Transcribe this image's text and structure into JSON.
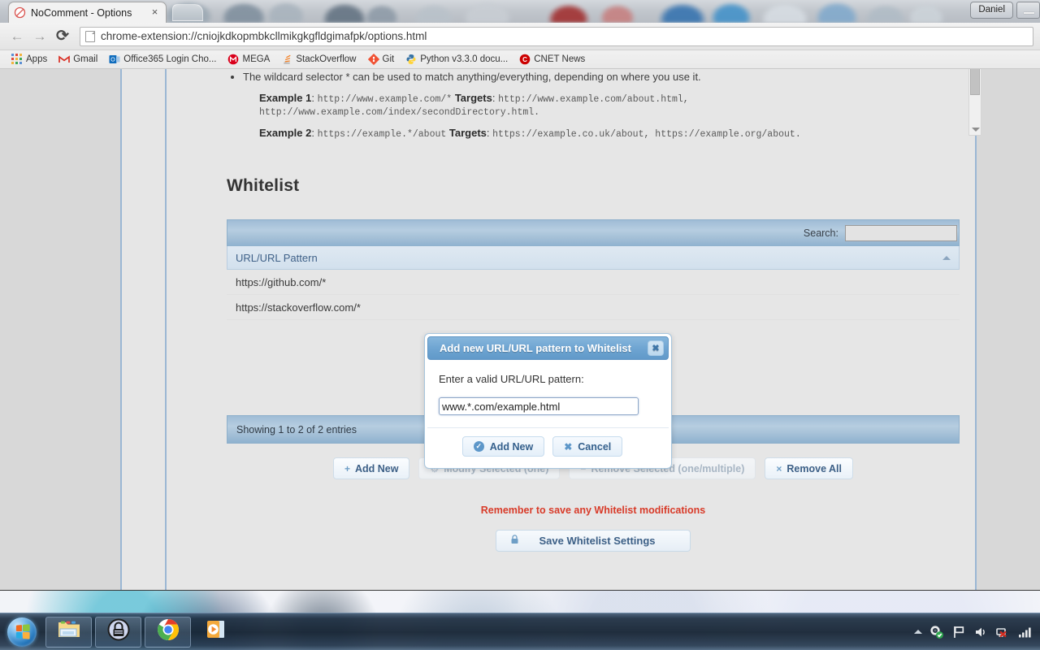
{
  "window": {
    "user_button": "Daniel",
    "minimize_label": "–"
  },
  "browser": {
    "tab": {
      "title": "NoComment - Options",
      "close": "×",
      "favicon": "no-comment-icon"
    },
    "nav": {
      "back": "←",
      "forward": "→",
      "reload": "⟳"
    },
    "omnibox": {
      "url": "chrome-extension://cniojkdkopmbkcllmikgkgfldgimafpk/options.html"
    },
    "bookmarks": [
      {
        "label": "Apps",
        "icon": "apps-grid-icon"
      },
      {
        "label": "Gmail",
        "icon": "gmail-icon"
      },
      {
        "label": "Office365 Login Cho...",
        "icon": "outlook-icon"
      },
      {
        "label": "MEGA",
        "icon": "mega-icon"
      },
      {
        "label": "StackOverflow",
        "icon": "stackoverflow-icon"
      },
      {
        "label": "Git",
        "icon": "git-icon"
      },
      {
        "label": "Python v3.3.0 docu...",
        "icon": "python-icon"
      },
      {
        "label": "CNET News",
        "icon": "cnet-icon"
      }
    ]
  },
  "help": {
    "bullet": "The wildcard selector * can be used to match anything/everything, depending on where you use it.",
    "examples": [
      {
        "name": "Example 1",
        "pattern": "http://www.example.com/*",
        "targets_label": "Targets",
        "targets": "http://www.example.com/about.html, http://www.example.com/index/secondDirectory.html."
      },
      {
        "name": "Example 2",
        "pattern": "https://example.*/about",
        "targets_label": "Targets",
        "targets": "https://example.co.uk/about, https://example.org/about."
      }
    ]
  },
  "whitelist": {
    "heading": "Whitelist",
    "search_label": "Search:",
    "search_value": "",
    "search_placeholder": "",
    "column_header": "URL/URL Pattern",
    "sort_direction": "ascending",
    "rows": [
      "https://github.com/*",
      "https://stackoverflow.com/*"
    ],
    "footer_info": "Showing 1 to 2 of 2 entries",
    "actions": [
      {
        "label": "Add New",
        "glyph": "+",
        "disabled": false,
        "name": "add-new-button"
      },
      {
        "label": "Modify Selected (one)",
        "glyph": "⚙",
        "disabled": true,
        "name": "modify-selected-button"
      },
      {
        "label": "Remove Selected (one/multiple)",
        "glyph": "−",
        "disabled": true,
        "name": "remove-selected-button"
      },
      {
        "label": "Remove All",
        "glyph": "×",
        "disabled": false,
        "name": "remove-all-button"
      }
    ],
    "warning": "Remember to save any Whitelist modifications",
    "save_label": "Save Whitelist Settings",
    "save_glyph": "🔒"
  },
  "modal": {
    "title": "Add new URL/URL pattern to Whitelist",
    "close_glyph": "✖",
    "prompt": "Enter a valid URL/URL pattern:",
    "input_value": "www.*.com/example.html",
    "input_placeholder": "",
    "confirm_label": "Add New",
    "confirm_glyph": "✓",
    "cancel_label": "Cancel",
    "cancel_glyph": "✖"
  },
  "taskbar": {
    "start": "start-orb",
    "items": [
      {
        "name": "windows-explorer-icon",
        "label": "Windows Explorer"
      },
      {
        "name": "keepass-icon",
        "label": "KeePass"
      },
      {
        "name": "google-chrome-icon",
        "label": "Google Chrome"
      },
      {
        "name": "media-player-icon",
        "label": "Windows Media Player"
      }
    ],
    "tray": [
      {
        "name": "show-hidden-icons-chevron",
        "label": "Show hidden icons"
      },
      {
        "name": "settings-gears-icon",
        "label": "Settings"
      },
      {
        "name": "action-center-flag-icon",
        "label": "Action Center"
      },
      {
        "name": "volume-speaker-icon",
        "label": "Volume"
      },
      {
        "name": "network-disconnected-icon",
        "label": "Network"
      },
      {
        "name": "signal-bars-icon",
        "label": "Signal strength"
      }
    ]
  },
  "colors": {
    "accent_blue": "#6fa5d2",
    "panel_header": "#9fbcd6",
    "warning_red": "#d83b29",
    "link_blue": "#3f6188"
  }
}
